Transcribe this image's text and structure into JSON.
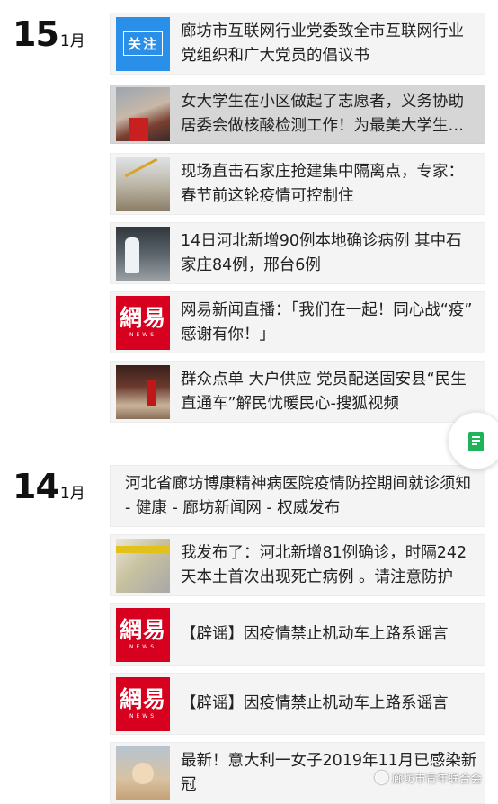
{
  "groups": [
    {
      "day": "15",
      "month": "1月",
      "articles": [
        {
          "title": "廊坊市互联网行业党委致全市互联网行业党组织和广大党员的倡议书",
          "thumb_text": "关注",
          "thumb_icon": "follow-badge-icon"
        },
        {
          "title": "女大学生在小区做起了志愿者，义务协助居委会做核酸检测工作！为最美大学生点赞",
          "thumb_icon": "photo-thumbnail"
        },
        {
          "title": "现场直击石家庄抢建集中隔离点，专家：春节前这轮疫情可控制住",
          "thumb_icon": "photo-thumbnail"
        },
        {
          "title": "14日河北新增90例本地确诊病例 其中石家庄84例，邢台6例",
          "thumb_icon": "photo-thumbnail"
        },
        {
          "title": "网易新闻直播：「我们在一起！同心战“疫” 感谢有你！」",
          "thumb_text": "網易",
          "thumb_subtext": "NEWS",
          "thumb_icon": "netease-logo"
        },
        {
          "title": "群众点单 大户供应 党员配送固安县“民生直通车”解民忧暖民心-搜狐视频",
          "thumb_icon": "photo-thumbnail"
        }
      ]
    },
    {
      "day": "14",
      "month": "1月",
      "articles": [
        {
          "title": "河北省廊坊博康精神病医院疫情防控期间就诊须知 - 健康 - 廊坊新闻网 - 权威发布"
        },
        {
          "title": "我发布了：河北新增81例确诊，时隔242天本土首次出现死亡病例 。请注意防护",
          "thumb_icon": "photo-thumbnail"
        },
        {
          "title": "【辟谣】因疫情禁止机动车上路系谣言",
          "thumb_text": "網易",
          "thumb_subtext": "NEWS",
          "thumb_icon": "netease-logo"
        },
        {
          "title": "【辟谣】因疫情禁止机动车上路系谣言",
          "thumb_text": "網易",
          "thumb_subtext": "NEWS",
          "thumb_icon": "netease-logo"
        },
        {
          "title": "最新！意大利一女子2019年11月已感染新冠",
          "thumb_icon": "photo-thumbnail"
        }
      ]
    }
  ],
  "float_button": {
    "icon": "document-icon"
  },
  "watermark": {
    "text": "廊坊市青年联合会",
    "icon": "wechat-channel-icon"
  },
  "colors": {
    "card_bg": "#f4f4f4",
    "selected_bg": "#d6d6d6",
    "netease_red": "#d7001f",
    "follow_blue": "#2a8fe8",
    "doc_green": "#1fb35a"
  }
}
